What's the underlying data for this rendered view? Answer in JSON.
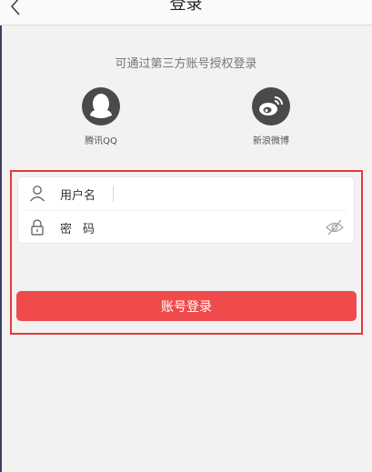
{
  "header": {
    "title": "登录",
    "back_icon": "chevron-left-icon"
  },
  "third_party": {
    "prompt": "可通过第三方账号授权登录",
    "providers": [
      {
        "label": "腾讯QQ",
        "icon": "qq-penguin-icon"
      },
      {
        "label": "新浪微博",
        "icon": "weibo-icon"
      }
    ]
  },
  "form": {
    "username_label": "用户名",
    "username_icon": "user-icon",
    "password_label": "密码",
    "password_icon": "lock-icon",
    "visibility_icon": "eye-hidden-icon"
  },
  "login_button": "账号登录",
  "colors": {
    "accent": "#ef4b4c",
    "highlight_frame": "#e5393a",
    "icon_dark": "#4a4a4a"
  }
}
